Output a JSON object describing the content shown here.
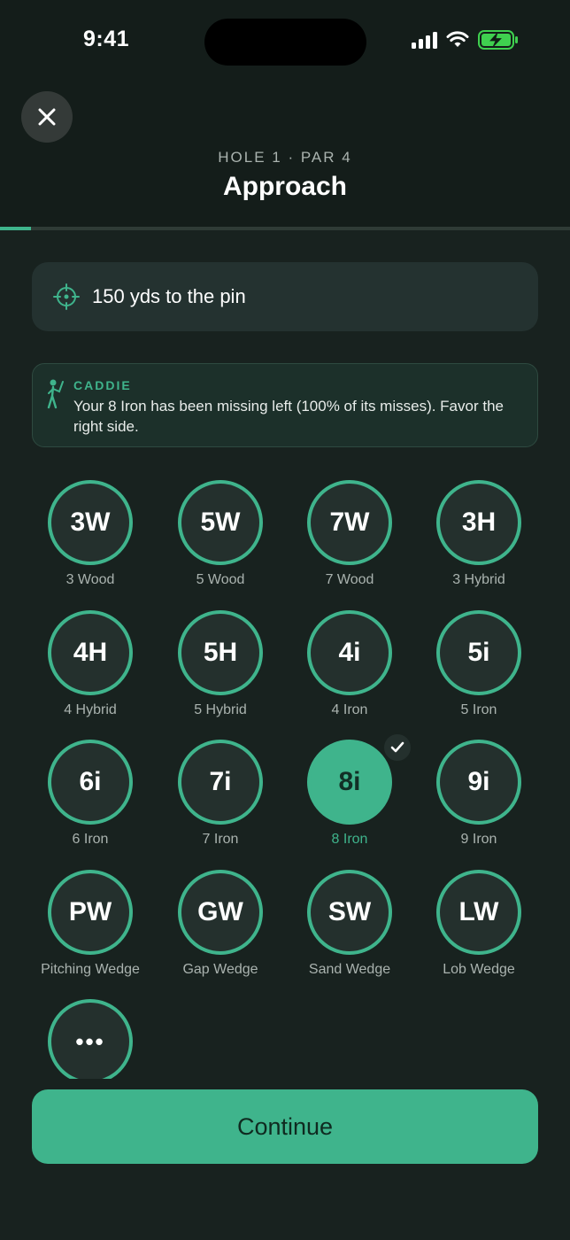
{
  "status_bar": {
    "time": "9:41"
  },
  "header": {
    "subtitle": "HOLE 1 · PAR 4",
    "title": "Approach",
    "progress": 0.055
  },
  "distance": {
    "text": "150 yds to the pin"
  },
  "caddie": {
    "label": "CADDIE",
    "message": "Your 8 Iron has been missing left (100% of its misses). Favor the right side."
  },
  "clubs": [
    {
      "abbr": "3W",
      "name": "3 Wood"
    },
    {
      "abbr": "5W",
      "name": "5 Wood"
    },
    {
      "abbr": "7W",
      "name": "7 Wood"
    },
    {
      "abbr": "3H",
      "name": "3 Hybrid"
    },
    {
      "abbr": "4H",
      "name": "4 Hybrid"
    },
    {
      "abbr": "5H",
      "name": "5 Hybrid"
    },
    {
      "abbr": "4i",
      "name": "4 Iron"
    },
    {
      "abbr": "5i",
      "name": "5 Iron"
    },
    {
      "abbr": "6i",
      "name": "6 Iron"
    },
    {
      "abbr": "7i",
      "name": "7 Iron"
    },
    {
      "abbr": "8i",
      "name": "8 Iron",
      "selected": true
    },
    {
      "abbr": "9i",
      "name": "9 Iron"
    },
    {
      "abbr": "PW",
      "name": "Pitching Wedge"
    },
    {
      "abbr": "GW",
      "name": "Gap Wedge"
    },
    {
      "abbr": "SW",
      "name": "Sand Wedge"
    },
    {
      "abbr": "LW",
      "name": "Lob Wedge"
    }
  ],
  "more_button": {
    "label": "•••"
  },
  "continue_button": {
    "label": "Continue"
  },
  "colors": {
    "accent": "#3fb48c",
    "background": "#141d1a",
    "card": "#243230"
  },
  "icons": [
    "close-icon",
    "crosshair-icon",
    "golfer-icon",
    "check-icon",
    "signal-icon",
    "wifi-icon",
    "battery-charging-icon"
  ]
}
